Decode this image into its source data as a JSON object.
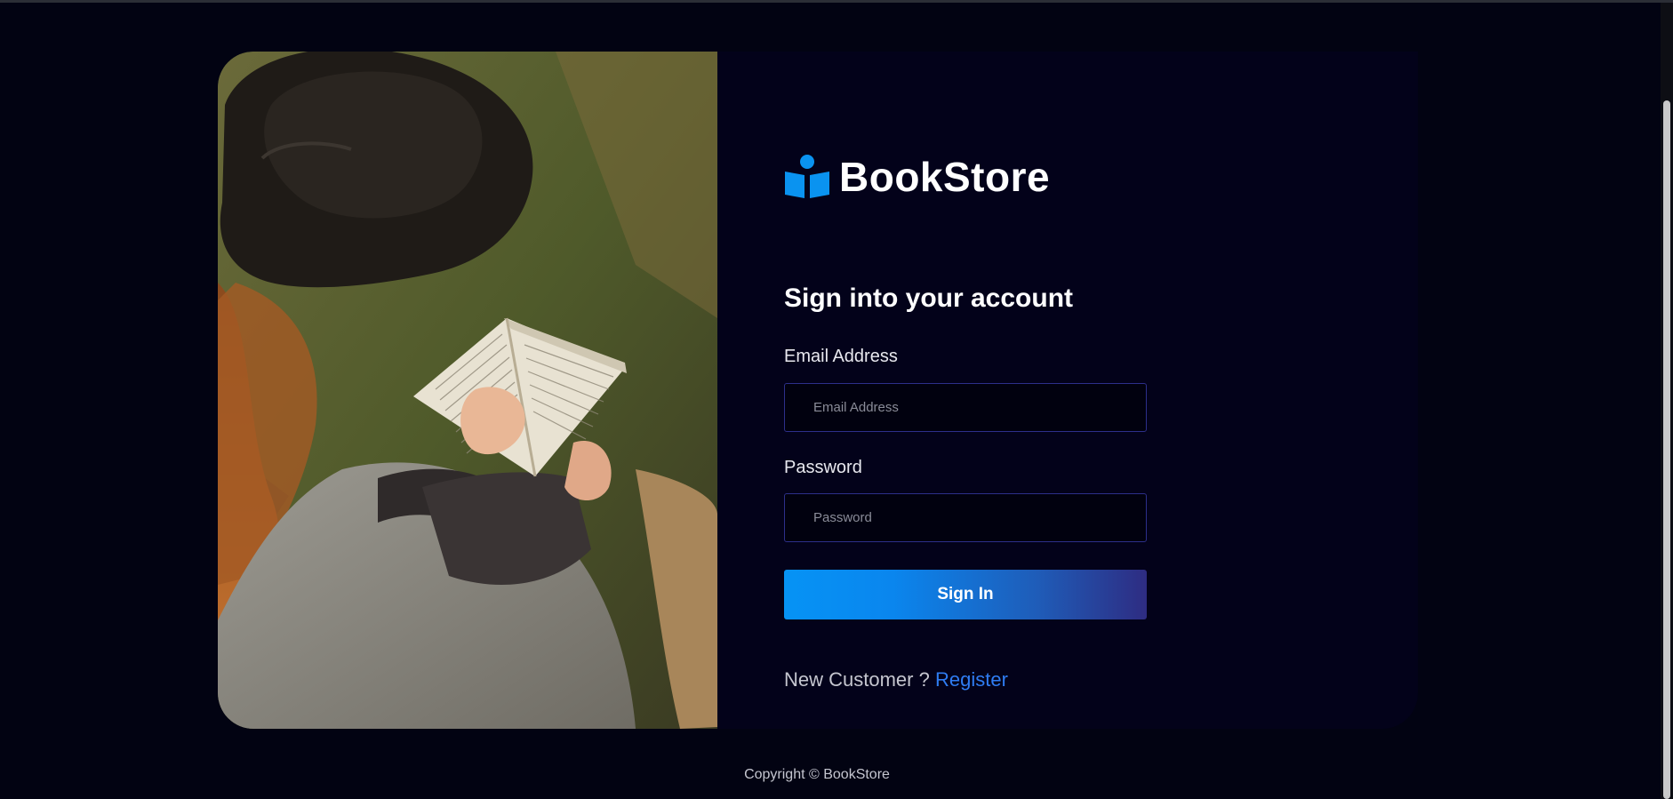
{
  "brand": {
    "icon": "reader-book-icon",
    "name": "BookStore",
    "color": "#0a93f0"
  },
  "photo": {
    "description_icon": "woman-reading-book-photo"
  },
  "form": {
    "heading": "Sign into your account",
    "email_label": "Email Address",
    "email_placeholder": "Email Address",
    "email_value": "",
    "password_label": "Password",
    "password_placeholder": "Password",
    "password_value": "",
    "submit_label": "Sign In",
    "new_customer_text": "New Customer ?",
    "register_label": "Register"
  },
  "footer": {
    "copyright": "Copyright © BookStore"
  },
  "colors": {
    "page_bg": "#020312",
    "card_bg": "#03021a",
    "accent": "#0693f5",
    "link": "#2f7cf2",
    "input_border": "#2c2f8a"
  }
}
